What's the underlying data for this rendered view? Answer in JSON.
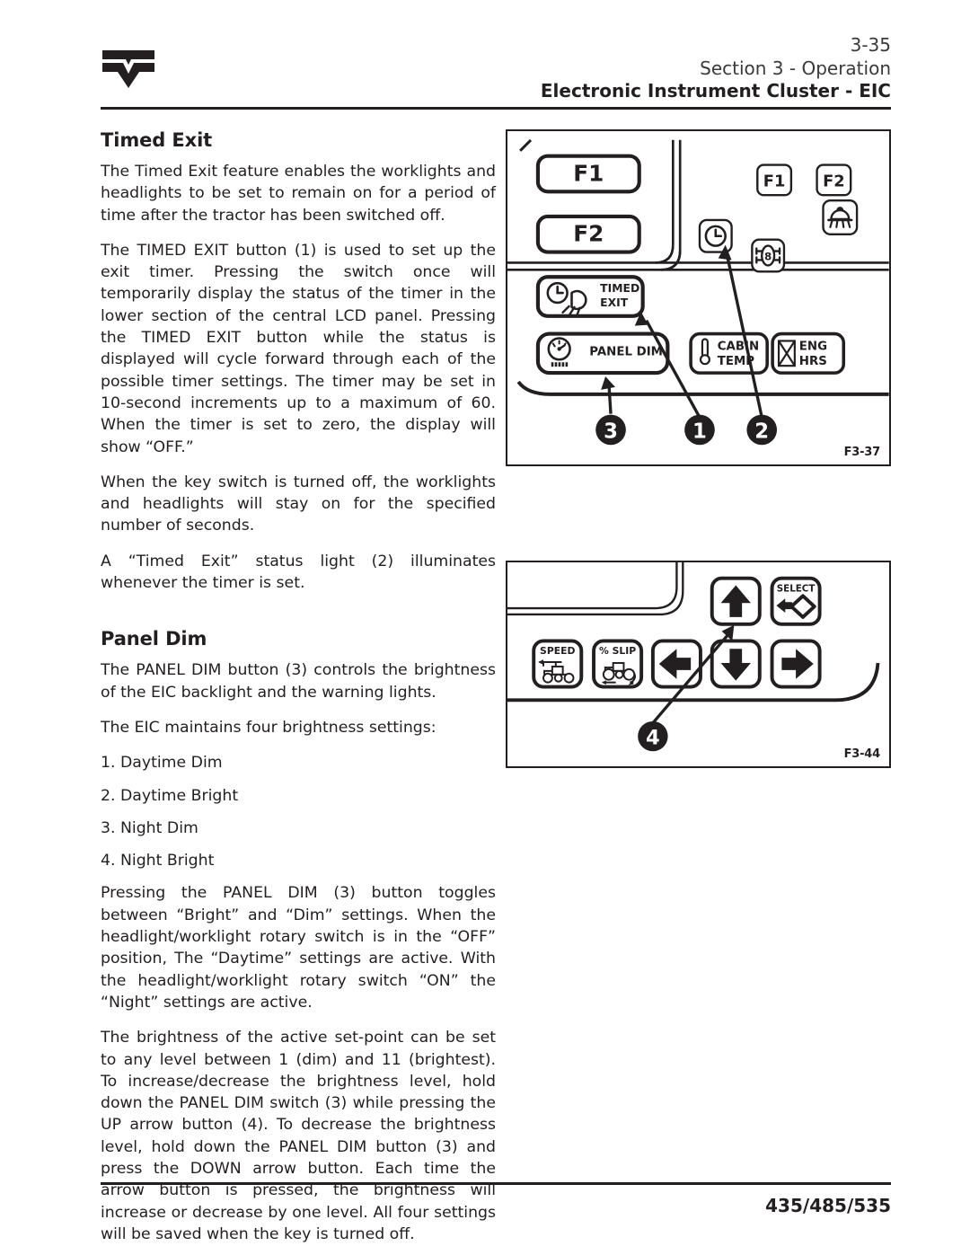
{
  "header": {
    "logo_name": "valtra-logo",
    "page_number": "3-35",
    "section": "Section 3 - Operation",
    "title": "Electronic Instrument Cluster - EIC"
  },
  "footer": {
    "models": "435/485/535"
  },
  "sections": [
    {
      "heading": "Timed Exit",
      "paragraphs": [
        "The Timed Exit feature enables the worklights and headlights to be set to remain on for a period of time after the tractor has been switched off.",
        "The TIMED EXIT button (1) is used to set up the exit timer. Pressing the switch once will temporarily display the status of the timer in the lower section of the central LCD panel. Pressing the TIMED EXIT button while the status is displayed will cycle forward through each of the possible timer settings. The timer may be set in 10-second increments up to a maximum of 60. When the timer is set to zero, the display will show “OFF.”",
        "When the key switch is turned off, the worklights and headlights will stay on for the specified number of seconds.",
        "A “Timed Exit” status light (2) illuminates whenever the timer is set."
      ]
    },
    {
      "heading": "Panel Dim",
      "paragraphs_before_list": [
        "The PANEL DIM button (3) controls the brightness of the EIC backlight and the warning lights.",
        "The EIC maintains four brightness settings:"
      ],
      "list": [
        "1. Daytime Dim",
        "2. Daytime Bright",
        "3. Night Dim",
        "4. Night Bright"
      ],
      "paragraphs_after_list": [
        "Pressing the PANEL DIM (3) button toggles between “Bright” and “Dim” settings. When the headlight/worklight rotary switch is in the “OFF” position, The “Daytime” settings are active. With the headlight/worklight rotary switch “ON” the “Night” settings are active.",
        "The brightness of the active set-point can be set to any level between 1 (dim) and 11 (brightest). To increase/decrease the brightness level, hold down the PANEL DIM switch (3) while pressing the UP arrow button (4). To decrease the brightness level, hold down the PANEL DIM button (3) and press the DOWN arrow button. Each time the arrow button is pressed, the brightness will increase or decrease by one level. All four settings will be saved when the key is turned off."
      ]
    }
  ],
  "figure_1": {
    "caption": "F3-37",
    "large_buttons": [
      {
        "label": "F1",
        "name": "f1-button"
      },
      {
        "label": "F2",
        "name": "f2-button"
      }
    ],
    "timed_exit_button": {
      "label_line1": "TIMED",
      "label_line2": "EXIT",
      "icon": "clock-headlight-icon"
    },
    "panel_dim_button": {
      "label": "PANEL DIM",
      "icon": "gauge-dim-icon"
    },
    "cabin_temp_button": {
      "label_line1": "CABIN",
      "label_line2": "TEMP",
      "icon": "thermometer-icon"
    },
    "eng_hrs_button": {
      "label_line1": "ENG",
      "label_line2": "HRS",
      "icon": "hourglass-icon"
    },
    "indicators": [
      {
        "label": "F1",
        "name": "indicator-f1"
      },
      {
        "label": "F2",
        "name": "indicator-f2"
      },
      {
        "label": "",
        "name": "indicator-clock-icon"
      },
      {
        "label": "",
        "name": "indicator-diff-lock-icon"
      },
      {
        "label": "",
        "name": "indicator-seat-icon"
      }
    ],
    "callouts": [
      {
        "number": "3",
        "target": "panel-dim-button"
      },
      {
        "number": "1",
        "target": "timed-exit-button"
      },
      {
        "number": "2",
        "target": "indicator-clock-icon"
      }
    ]
  },
  "figure_2": {
    "caption": "F3-44",
    "speed_button": {
      "label": "SPEED",
      "icon": "tractor-speed-icon"
    },
    "slip_button": {
      "label": "% SLIP",
      "icon": "tractor-slip-icon"
    },
    "select_button": {
      "label": "SELECT",
      "icon": "arrow-diamond-icon"
    },
    "arrow_buttons": [
      {
        "name": "up-arrow-button",
        "icon": "arrow-up-icon"
      },
      {
        "name": "left-arrow-button",
        "icon": "arrow-left-icon"
      },
      {
        "name": "down-arrow-button",
        "icon": "arrow-down-icon"
      },
      {
        "name": "right-arrow-button",
        "icon": "arrow-right-icon"
      }
    ],
    "callouts": [
      {
        "number": "4",
        "target": "up-arrow-button"
      }
    ]
  },
  "colors": {
    "ink": "#231f20",
    "paper": "#ffffff"
  }
}
